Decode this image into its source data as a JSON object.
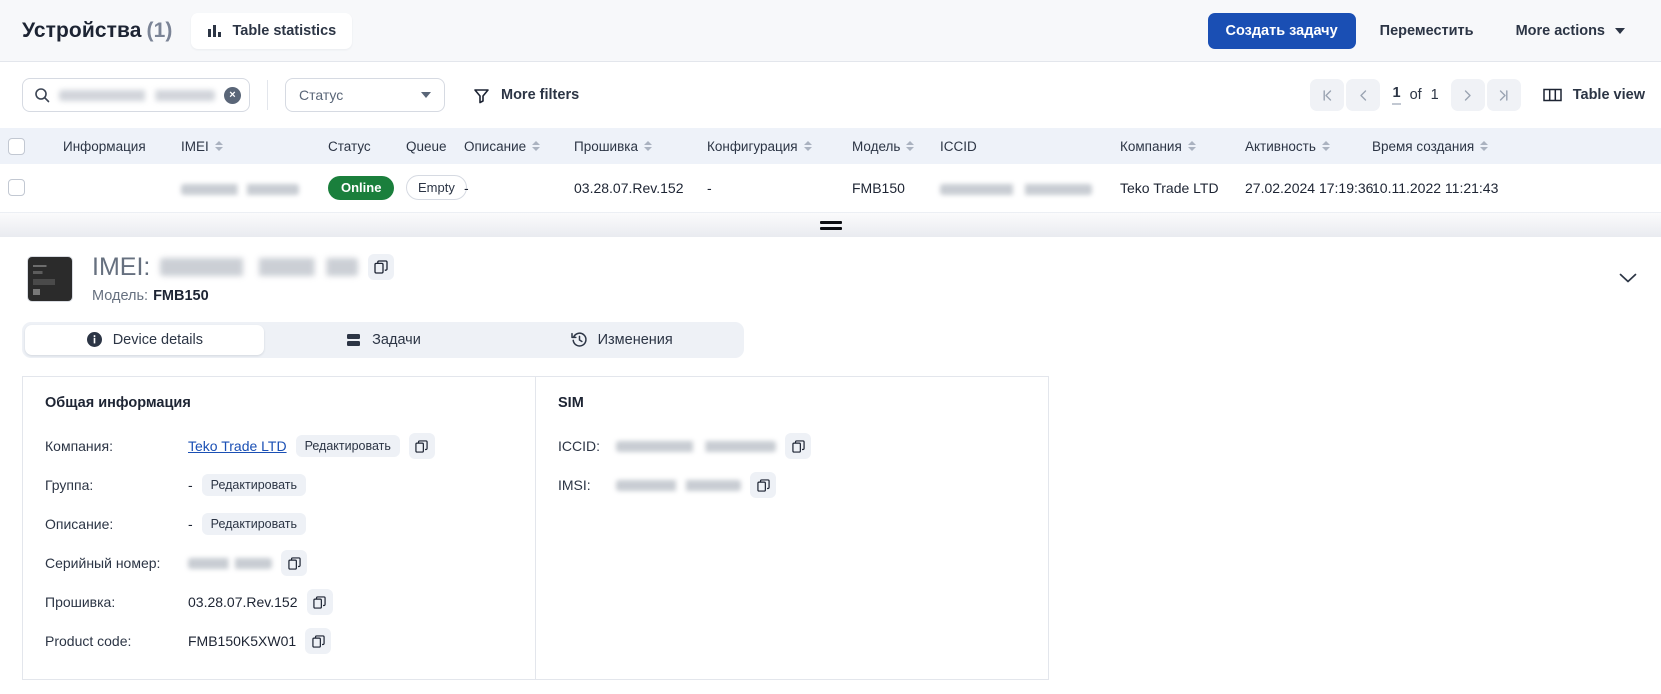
{
  "header": {
    "title": "Устройства",
    "count": "(1)",
    "stats_button": "Table statistics",
    "primary_button": "Создать задачу",
    "move_button": "Переместить",
    "more_actions_button": "More actions"
  },
  "filters": {
    "search_value": "",
    "search_redacted": true,
    "status_select": "Статус",
    "more_filters": "More filters"
  },
  "pagination": {
    "first": "|<",
    "prev": "<",
    "current": "1",
    "of_label": "of",
    "total": "1",
    "next": ">",
    "last": ">|",
    "table_view": "Table view"
  },
  "table": {
    "columns": [
      {
        "label": "Информация",
        "sortable": false
      },
      {
        "label": "IMEI",
        "sortable": true
      },
      {
        "label": "Статус",
        "sortable": false
      },
      {
        "label": "Queue",
        "sortable": false
      },
      {
        "label": "Описание",
        "sortable": true
      },
      {
        "label": "Прошивка",
        "sortable": true
      },
      {
        "label": "Конфигурация",
        "sortable": true
      },
      {
        "label": "Модель",
        "sortable": true
      },
      {
        "label": "ICCID",
        "sortable": false
      },
      {
        "label": "Компания",
        "sortable": true
      },
      {
        "label": "Активность",
        "sortable": true
      },
      {
        "label": "Время создания",
        "sortable": true
      }
    ],
    "rows": [
      {
        "info": "",
        "imei": "",
        "status": "Online",
        "queue": "Empty",
        "description": "-",
        "firmware": "03.28.07.Rev.152",
        "configuration": "-",
        "model": "FMB150",
        "iccid": "",
        "company": "Teko Trade LTD",
        "activity": "27.02.2024 17:19:36",
        "created": "10.11.2022 11:21:43"
      }
    ]
  },
  "detail": {
    "imei_label": "IMEI:",
    "imei_value": "",
    "model_label": "Модель:",
    "model_value": "FMB150",
    "tabs": [
      {
        "label": "Device details",
        "icon": "info-icon",
        "active": true
      },
      {
        "label": "Задачи",
        "icon": "tasks-icon",
        "active": false
      },
      {
        "label": "Изменения",
        "icon": "history-icon",
        "active": false
      }
    ],
    "general": {
      "title": "Общая информация",
      "rows": [
        {
          "label": "Компания:",
          "value": "Teko Trade LTD",
          "type": "link",
          "edit": "Редактировать",
          "copy": true
        },
        {
          "label": "Группа:",
          "value": "-",
          "type": "text",
          "edit": "Редактировать",
          "copy": false
        },
        {
          "label": "Описание:",
          "value": "-",
          "type": "text",
          "edit": "Редактировать",
          "copy": false
        },
        {
          "label": "Серийный номер:",
          "value": "",
          "type": "redacted",
          "edit": "",
          "copy": true
        },
        {
          "label": "Прошивка:",
          "value": "03.28.07.Rev.152",
          "type": "text",
          "edit": "",
          "copy": true
        },
        {
          "label": "Product code:",
          "value": "FMB150K5XW01",
          "type": "text",
          "edit": "",
          "copy": true
        }
      ]
    },
    "sim": {
      "title": "SIM",
      "rows": [
        {
          "label": "ICCID:",
          "value": "",
          "type": "redacted",
          "copy": true
        },
        {
          "label": "IMSI:",
          "value": "",
          "type": "redacted",
          "copy": true
        }
      ]
    }
  },
  "colors": {
    "primary": "#1a4fb4",
    "online": "#1a7f3c",
    "header_bg": "#f7f8fa",
    "table_header_bg": "#eef2f9",
    "link": "#1a4fb4"
  }
}
